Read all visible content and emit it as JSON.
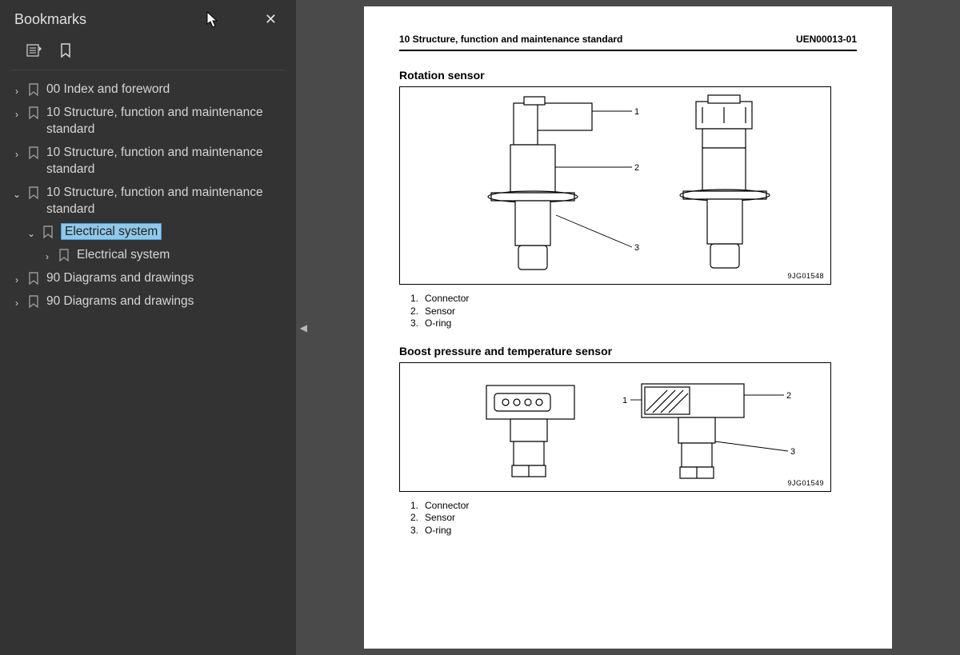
{
  "sidebar": {
    "title": "Bookmarks",
    "items": [
      {
        "label": "00 Index and foreword",
        "expand": "›",
        "indent": 0,
        "selected": false
      },
      {
        "label": "10 Structure, function and maintenance standard",
        "expand": "›",
        "indent": 0,
        "selected": false
      },
      {
        "label": "10 Structure, function and maintenance standard",
        "expand": "›",
        "indent": 0,
        "selected": false
      },
      {
        "label": "10 Structure, function and maintenance standard",
        "expand": "⌄",
        "indent": 0,
        "selected": false
      },
      {
        "label": "Electrical system",
        "expand": "⌄",
        "indent": 1,
        "selected": true
      },
      {
        "label": "Electrical system",
        "expand": "›",
        "indent": 2,
        "selected": false
      },
      {
        "label": "90 Diagrams and drawings",
        "expand": "›",
        "indent": 0,
        "selected": false
      },
      {
        "label": "90 Diagrams and drawings",
        "expand": "›",
        "indent": 0,
        "selected": false
      }
    ]
  },
  "page": {
    "header_left": "10 Structure, function and maintenance standard",
    "header_right": "UEN00013-01",
    "sections": [
      {
        "title": "Rotation sensor",
        "fig_code": "9JG01548",
        "callouts": [
          "1",
          "2",
          "3"
        ],
        "parts": [
          {
            "n": "1.",
            "t": "Connector"
          },
          {
            "n": "2.",
            "t": "Sensor"
          },
          {
            "n": "3.",
            "t": "O-ring"
          }
        ]
      },
      {
        "title": "Boost pressure and temperature sensor",
        "fig_code": "9JG01549",
        "callouts": [
          "1",
          "2",
          "3"
        ],
        "parts": [
          {
            "n": "1.",
            "t": "Connector"
          },
          {
            "n": "2.",
            "t": "Sensor"
          },
          {
            "n": "3.",
            "t": "O-ring"
          }
        ]
      }
    ]
  }
}
